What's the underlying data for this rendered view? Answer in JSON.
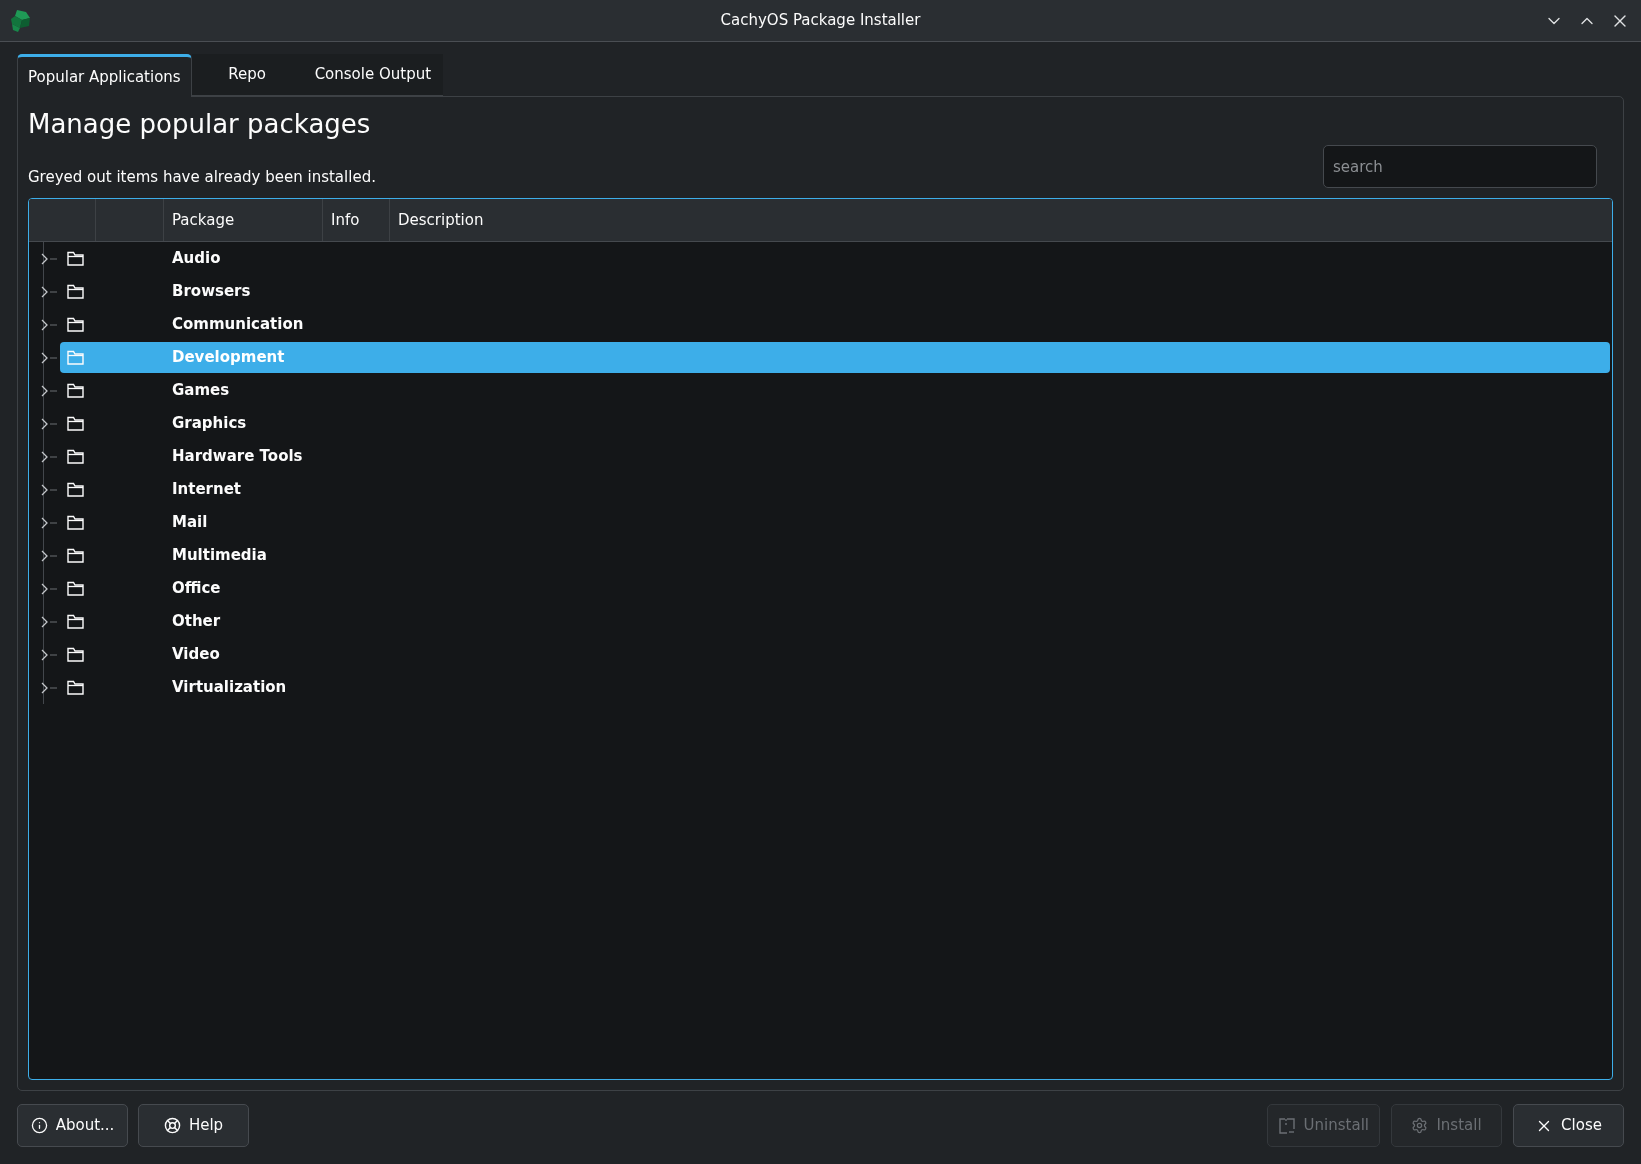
{
  "window": {
    "title": "CachyOS Package Installer"
  },
  "tabs": [
    {
      "label": "Popular Applications",
      "selected": true
    },
    {
      "label": "Repo",
      "selected": false
    },
    {
      "label": "Console Output",
      "selected": false
    }
  ],
  "page": {
    "heading": "Manage popular packages",
    "note": "Greyed out items have already been installed."
  },
  "search": {
    "placeholder": "search"
  },
  "table": {
    "columns": [
      "Package",
      "Info",
      "Description"
    ],
    "rows": [
      {
        "label": "Audio",
        "expanded": false,
        "selected": false
      },
      {
        "label": "Browsers",
        "expanded": false,
        "selected": false
      },
      {
        "label": "Communication",
        "expanded": false,
        "selected": false
      },
      {
        "label": "Development",
        "expanded": false,
        "selected": true
      },
      {
        "label": "Games",
        "expanded": false,
        "selected": false
      },
      {
        "label": "Graphics",
        "expanded": false,
        "selected": false
      },
      {
        "label": "Hardware Tools",
        "expanded": false,
        "selected": false
      },
      {
        "label": "Internet",
        "expanded": false,
        "selected": false
      },
      {
        "label": "Mail",
        "expanded": false,
        "selected": false
      },
      {
        "label": "Multimedia",
        "expanded": false,
        "selected": false
      },
      {
        "label": "Office",
        "expanded": false,
        "selected": false
      },
      {
        "label": "Other",
        "expanded": false,
        "selected": false
      },
      {
        "label": "Video",
        "expanded": false,
        "selected": false
      },
      {
        "label": "Virtualization",
        "expanded": false,
        "selected": false
      }
    ]
  },
  "buttons": {
    "left": [
      {
        "kind": "about",
        "label": "About...",
        "disabled": false
      },
      {
        "kind": "help",
        "label": "Help",
        "disabled": false
      }
    ],
    "right": [
      {
        "kind": "uninstall",
        "label": "Uninstall",
        "disabled": true
      },
      {
        "kind": "install",
        "label": "Install",
        "disabled": true
      },
      {
        "kind": "close",
        "label": "Close",
        "disabled": false
      }
    ]
  }
}
